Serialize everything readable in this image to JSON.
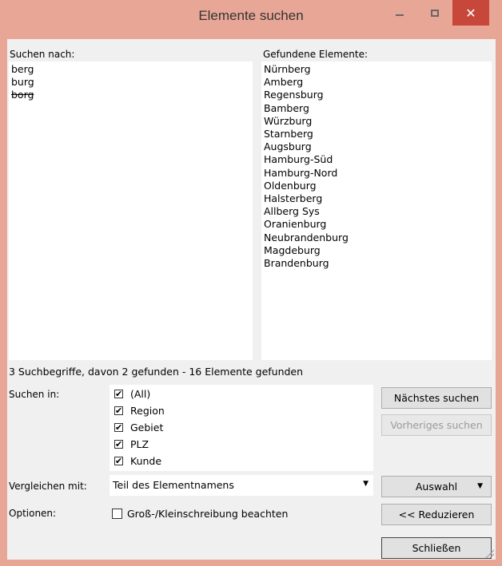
{
  "window": {
    "title": "Elemente suchen",
    "accent": "#e8a796",
    "close_color": "#c7473a",
    "minimize_icon": "minimize-icon",
    "maximize_icon": "maximize-icon",
    "close_icon": "close-icon",
    "close_glyph": "✕"
  },
  "search": {
    "label": "Suchen nach:",
    "terms": [
      "berg",
      "burg",
      "borg"
    ],
    "struck_terms": [
      "borg"
    ]
  },
  "results": {
    "label": "Gefundene Elemente:",
    "items": [
      "Nürnberg",
      "Amberg",
      "Regensburg",
      "Bamberg",
      "Würzburg",
      "Starnberg",
      "Augsburg",
      "Hamburg-Süd",
      "Hamburg-Nord",
      "Oldenburg",
      "Halsterberg",
      "Allberg Sys",
      "Oranienburg",
      "Neubrandenburg",
      "Magdeburg",
      "Brandenburg"
    ]
  },
  "status": "3 Suchbegriffe, davon 2 gefunden - 16 Elemente gefunden",
  "search_in": {
    "label": "Suchen in:",
    "items": [
      {
        "label": "(All)",
        "checked": true
      },
      {
        "label": "Region",
        "checked": true
      },
      {
        "label": "Gebiet",
        "checked": true
      },
      {
        "label": "PLZ",
        "checked": true
      },
      {
        "label": "Kunde",
        "checked": true
      }
    ],
    "check_glyph": "✔"
  },
  "compare": {
    "label": "Vergleichen mit:",
    "value": "Teil des Elementnamens",
    "arrow": "▼"
  },
  "options": {
    "label": "Optionen:",
    "case_label": "Groß-/Kleinschreibung beachten",
    "case_checked": false
  },
  "buttons": {
    "next": "Nächstes suchen",
    "previous": "Vorheriges suchen",
    "select": "Auswahl",
    "select_arrow": "▼",
    "reduce": "<< Reduzieren",
    "close": "Schließen"
  }
}
